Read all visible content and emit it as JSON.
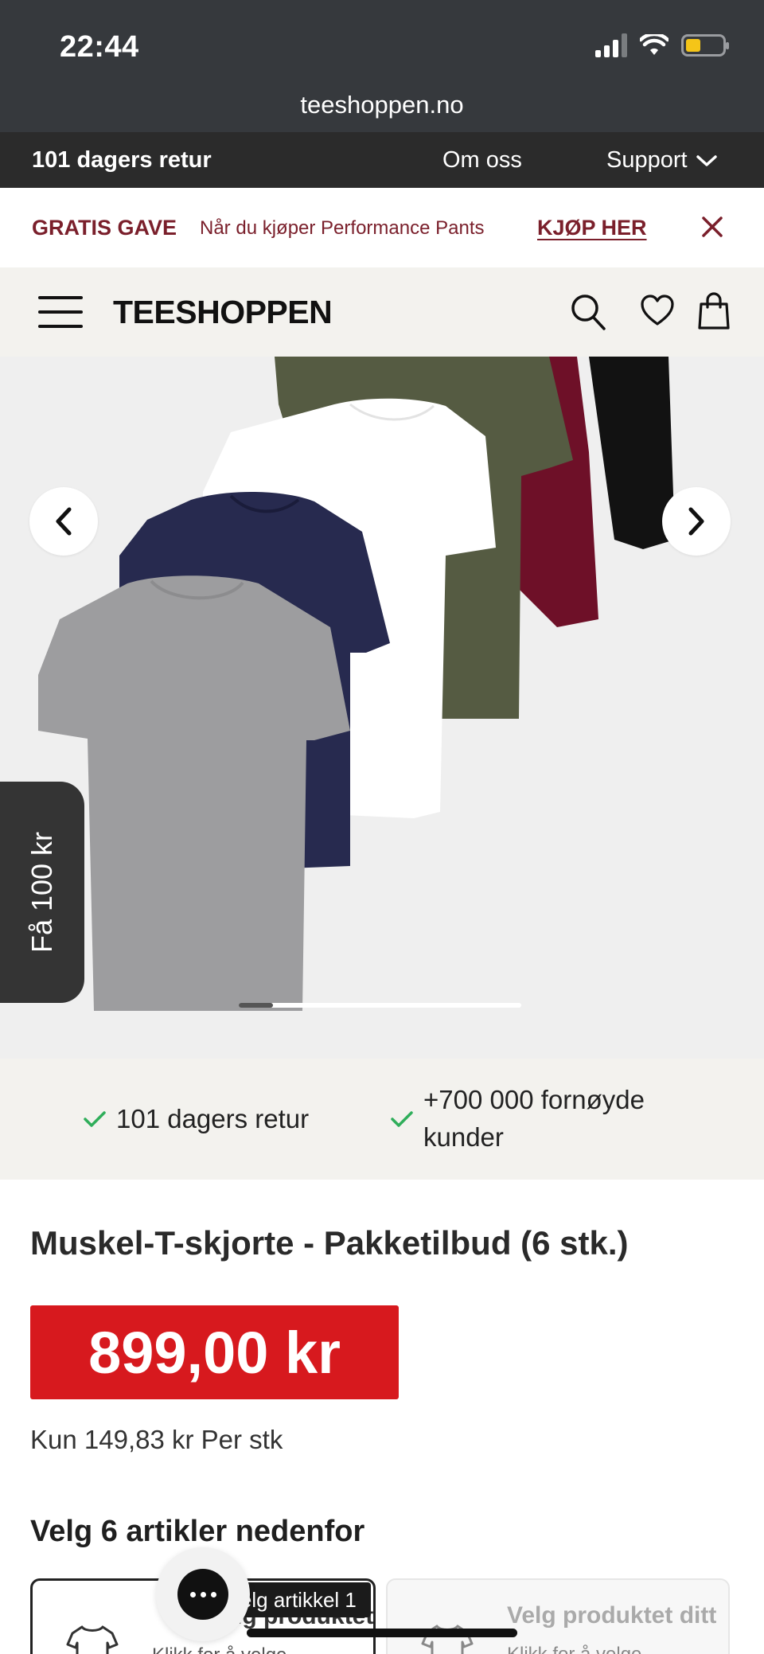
{
  "status_bar": {
    "time": "22:44"
  },
  "browser": {
    "url": "teeshoppen.no"
  },
  "top_nav": {
    "returns": "101 dagers retur",
    "about": "Om oss",
    "support": "Support"
  },
  "promo": {
    "gift": "GRATIS GAVE",
    "description": "Når du kjøper Performance Pants",
    "cta": "KJØP HER"
  },
  "header": {
    "logo": "TEESHOPPEN"
  },
  "gallery": {
    "progress": 0.12
  },
  "coupon_tab": {
    "label": "Få 100 kr"
  },
  "usp": {
    "item1": "101 dagers retur",
    "item2_line1": "+700 000 fornøyde",
    "item2_line2": "kunder"
  },
  "product": {
    "title": "Muskel-T-skjorte - Pakketilbud (6 stk.)",
    "price": "899,00 kr",
    "unit_price": "Kun 149,83 kr Per stk",
    "select_title": "Velg 6 artikler nedenfor"
  },
  "cards": [
    {
      "title": "Velg produktet ditt",
      "subtitle": "Klikk for å velge"
    },
    {
      "title": "Velg produktet ditt",
      "subtitle": "Klikk for å velge"
    }
  ],
  "chat": {
    "tooltip": "Velg artikkel 1"
  },
  "colors": {
    "promo_red": "#7a1f2b",
    "price_red": "#d7191e",
    "usp_check": "#2fae5a"
  }
}
